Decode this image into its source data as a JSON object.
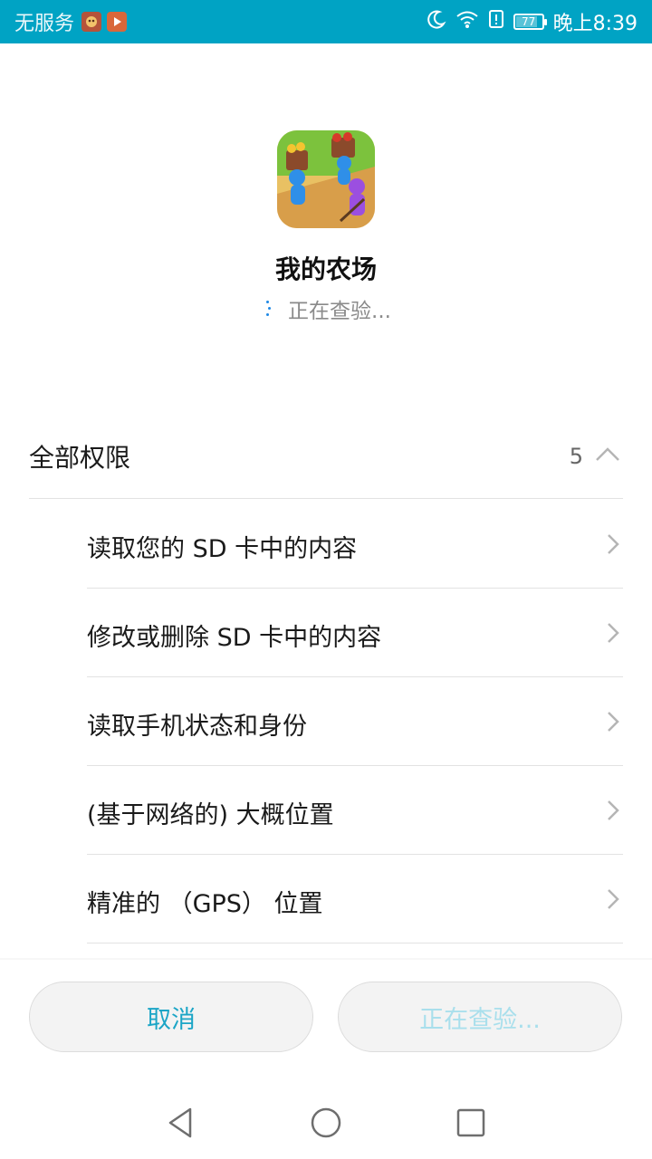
{
  "status_bar": {
    "carrier": "无服务",
    "time": "晚上8:39",
    "battery": "77",
    "icons": [
      "app-notification-icon",
      "video-notification-icon",
      "moon-icon",
      "wifi-icon",
      "alert-icon",
      "battery-icon"
    ]
  },
  "app": {
    "name": "我的农场",
    "status": "正在查验..."
  },
  "permissions": {
    "title": "全部权限",
    "count": "5",
    "items": [
      {
        "label": "读取您的 SD 卡中的内容"
      },
      {
        "label": "修改或删除 SD 卡中的内容"
      },
      {
        "label": "读取手机状态和身份"
      },
      {
        "label": "(基于网络的) 大概位置"
      },
      {
        "label": "精准的 （GPS） 位置"
      }
    ]
  },
  "buttons": {
    "cancel": "取消",
    "install": "正在查验..."
  },
  "colors": {
    "status_bar": "#00a3c4",
    "accent": "#1ba5c6",
    "disabled_text": "#a9dfec"
  },
  "nav": {
    "icons": [
      "back-icon",
      "home-icon",
      "recent-apps-icon"
    ]
  }
}
